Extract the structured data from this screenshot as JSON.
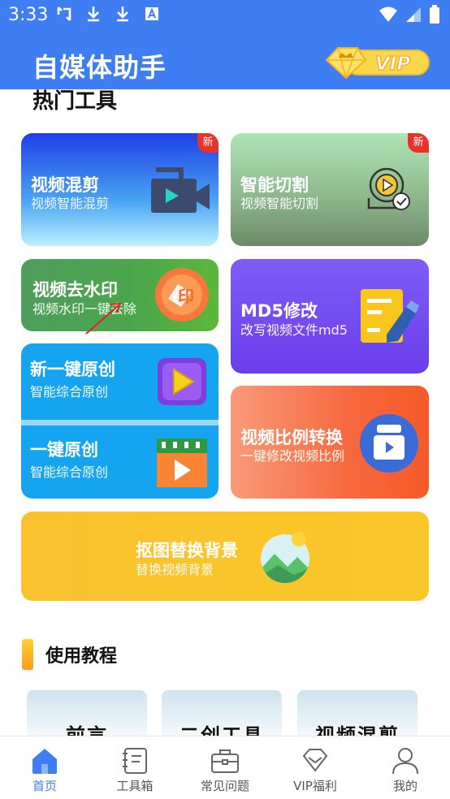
{
  "status_bar": {
    "time": "3:33"
  },
  "app_bar": {
    "title": "自媒体助手",
    "vip_label": "VIP"
  },
  "hot_tools": {
    "heading": "热门工具",
    "new_tag": "新",
    "cards": {
      "video_mix": {
        "title": "视频混剪",
        "subtitle": "视频智能混剪"
      },
      "smart_cut": {
        "title": "智能切割",
        "subtitle": "视频智能切割"
      },
      "watermark": {
        "title": "视频去水印",
        "subtitle": "视频水印一键去除",
        "icon_text": "印"
      },
      "md5": {
        "title": "MD5修改",
        "subtitle": "改写视频文件md5"
      },
      "new_original": {
        "title": "新一键原创",
        "subtitle": "智能综合原创"
      },
      "original": {
        "title": "一键原创",
        "subtitle": "智能综合原创"
      },
      "ratio": {
        "title": "视频比例转换",
        "subtitle": "一键修改视频比例"
      },
      "matting": {
        "title": "抠图替换背景",
        "subtitle": "替换视频背景"
      }
    }
  },
  "tutorials": {
    "heading": "使用教程",
    "items": [
      "前言",
      "二创工具",
      "视频混剪"
    ]
  },
  "bottom_nav": {
    "items": [
      {
        "label": "首页",
        "icon": "home-icon",
        "active": true
      },
      {
        "label": "工具箱",
        "icon": "notebook-icon",
        "active": false
      },
      {
        "label": "常见问题",
        "icon": "briefcase-icon",
        "active": false
      },
      {
        "label": "VIP福利",
        "icon": "diamond-icon",
        "active": false
      },
      {
        "label": "我的",
        "icon": "user-icon",
        "active": false
      }
    ]
  },
  "colors": {
    "primary": "#3e7ef2",
    "new_tag": "#e8332b"
  }
}
